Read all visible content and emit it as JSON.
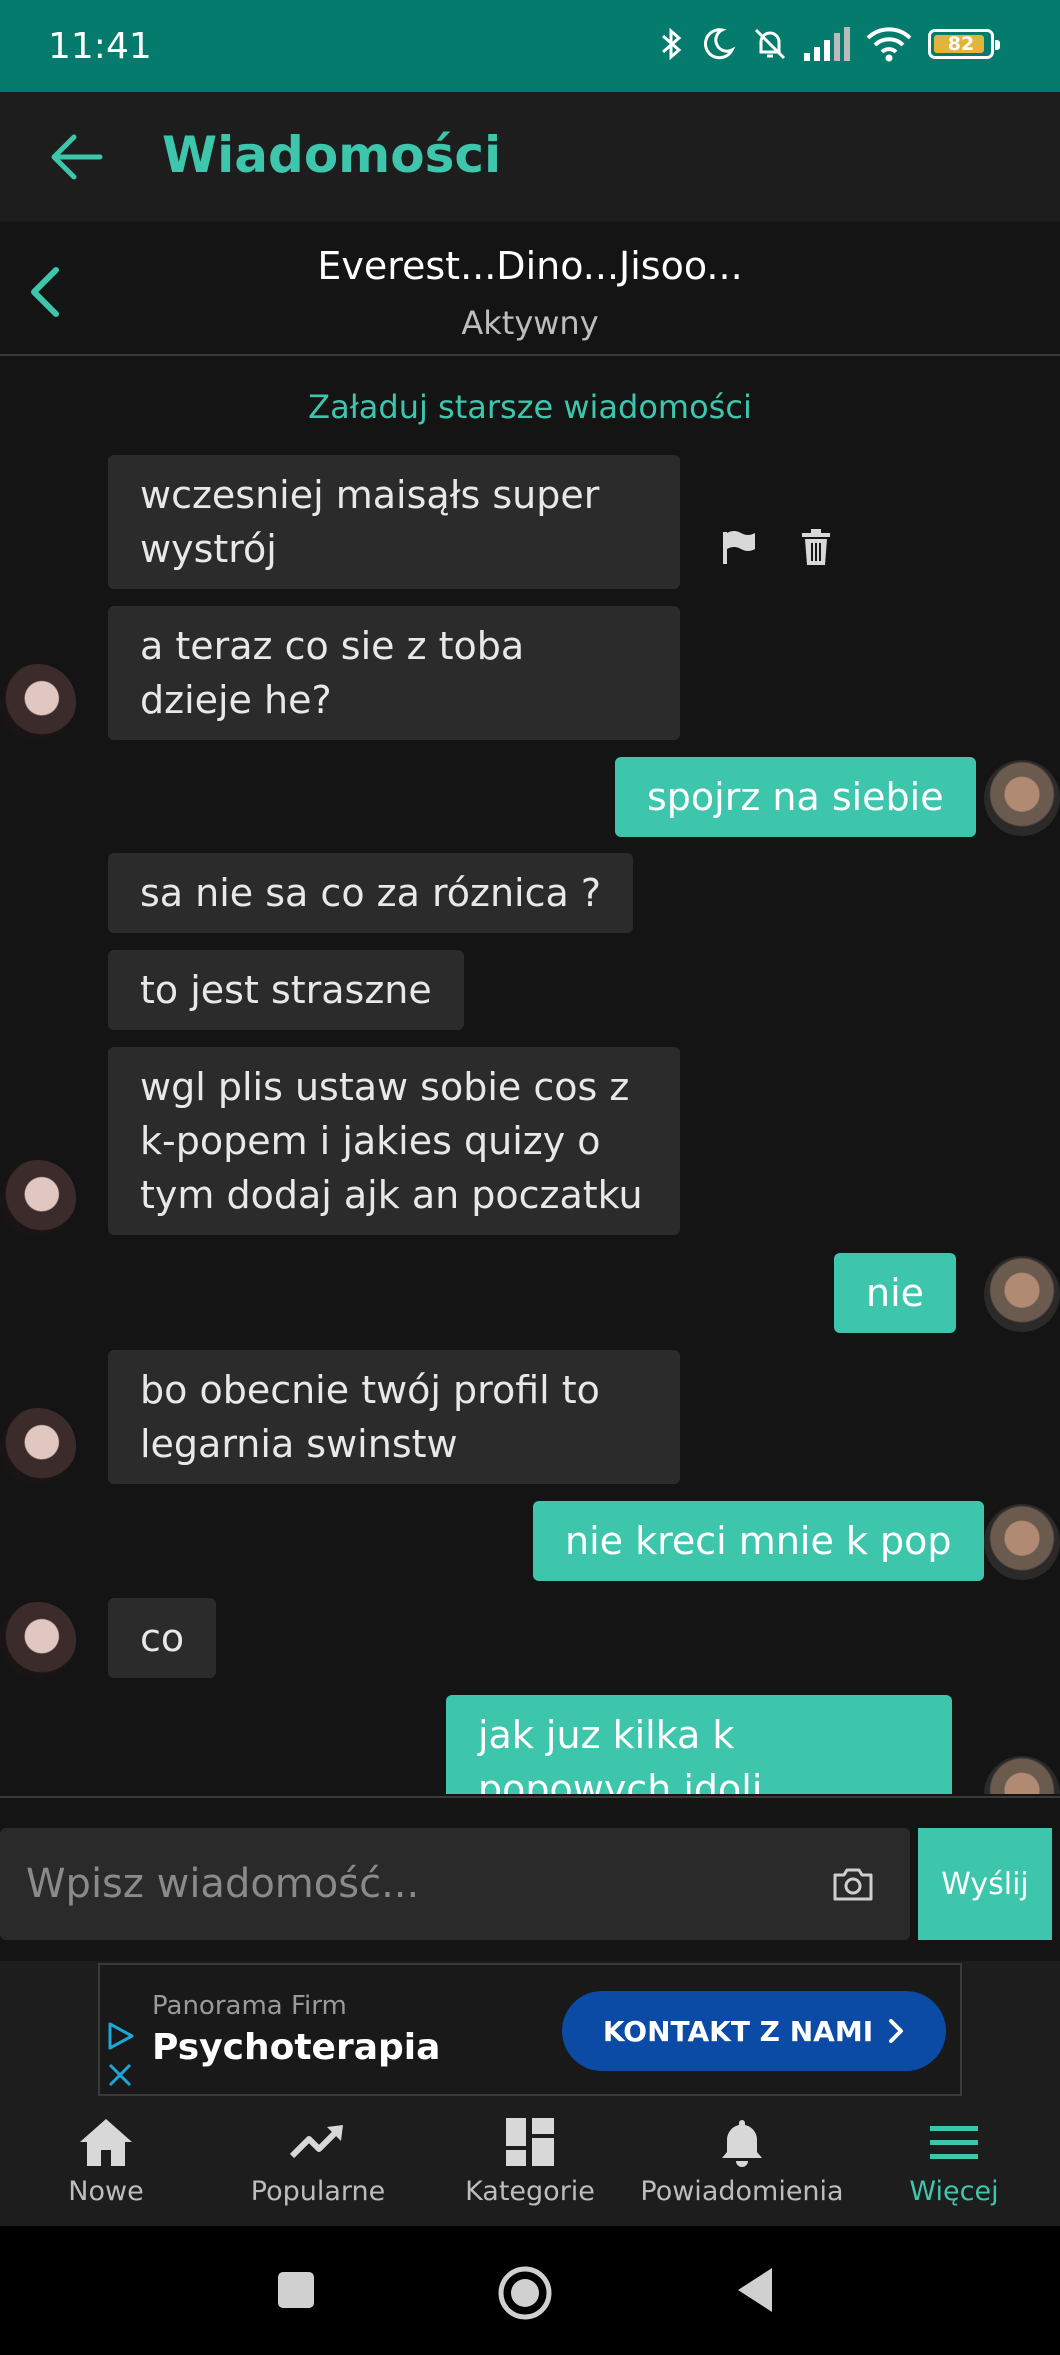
{
  "status_bar": {
    "time": "11:41",
    "battery": "82"
  },
  "header": {
    "title": "Wiadomości"
  },
  "conversation": {
    "names": "Everest...Dino...Jisoo...",
    "status": "Aktywny"
  },
  "load_older": "Załaduj starsze wiadomości",
  "messages": [
    {
      "dir": "in",
      "text": "wczesniej maisąłs super wystrój"
    },
    {
      "dir": "in",
      "text": "a teraz co sie z toba dzieje he?"
    },
    {
      "dir": "out",
      "text": "spojrz na siebie"
    },
    {
      "dir": "in",
      "text": "sa nie sa co za róznica ?"
    },
    {
      "dir": "in",
      "text": "to jest straszne"
    },
    {
      "dir": "in",
      "text": "wgl plis ustaw sobie cos z k-popem i jakies quizy o tym dodaj ajk an poczatku"
    },
    {
      "dir": "out",
      "text": "nie"
    },
    {
      "dir": "in",
      "text": "bo obecnie twój profil to legarnia swinstw"
    },
    {
      "dir": "out",
      "text": "nie kreci mnie k pop"
    },
    {
      "dir": "in",
      "text": "co"
    },
    {
      "dir": "out",
      "text": "jak juz kilka k popowych idoli"
    }
  ],
  "input": {
    "placeholder": "Wpisz wiadomość...",
    "send_label": "Wyślij"
  },
  "ad": {
    "source": "Panorama Firm",
    "title": "Psychoterapia",
    "button": "KONTAKT Z NAMI"
  },
  "nav": [
    {
      "label": "Nowe",
      "icon": "home-icon"
    },
    {
      "label": "Popularne",
      "icon": "trending-icon"
    },
    {
      "label": "Kategorie",
      "icon": "grid-icon"
    },
    {
      "label": "Powiadomienia",
      "icon": "bell-icon"
    },
    {
      "label": "Więcej",
      "icon": "menu-icon"
    }
  ],
  "colors": {
    "accent": "#3ec6ad",
    "status_bar": "#047b6c",
    "incoming_bubble": "#2b2b2b",
    "ad_button": "#0b4aa5"
  }
}
